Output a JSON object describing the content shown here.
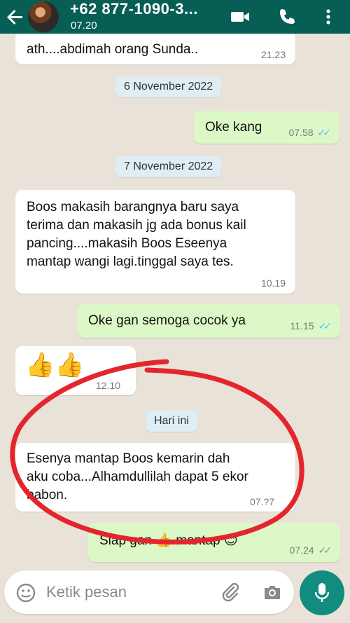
{
  "header": {
    "back_icon": "arrow-left-icon",
    "contact_name": "+62 877-1090-3...",
    "last_seen": "07.20",
    "video_icon": "video-call-icon",
    "call_icon": "phone-icon",
    "menu_icon": "more-vertical-icon"
  },
  "messages": [
    {
      "dir": "in",
      "text": "ath....abdimah orang Sunda..",
      "time": "21.23"
    },
    {
      "type": "date",
      "text": "6 November 2022"
    },
    {
      "dir": "out",
      "text": "Oke kang",
      "time": "07.58",
      "status": "read"
    },
    {
      "type": "date",
      "text": "7 November 2022"
    },
    {
      "dir": "in",
      "lines": [
        "Boos makasih barangnya baru saya",
        "terima dan makasih jg ada bonus kail",
        "pancing....makasih Boos Eseenya",
        "mantap wangi lagi.tinggal saya tes."
      ],
      "time": "10.19"
    },
    {
      "dir": "out",
      "text": "Oke gan semoga cocok ya",
      "time": "11.15",
      "status": "read"
    },
    {
      "dir": "in",
      "text": "👍👍",
      "time": "12.10"
    },
    {
      "type": "date",
      "text": "Hari ini"
    },
    {
      "dir": "in",
      "lines": [
        "Esenya mantap Boos kemarin dah",
        "aku coba...Alhamdullilah dapat 5 ekor",
        "babon."
      ],
      "time": "07.?7"
    },
    {
      "dir": "out",
      "text_parts": [
        "Siap gan",
        "👍",
        "mantap",
        "😊"
      ],
      "time": "07.24",
      "status": "delivered"
    }
  ],
  "input": {
    "placeholder": "Ketik pesan",
    "emoji_icon": "emoji-icon",
    "attach_icon": "paperclip-icon",
    "camera_icon": "camera-icon",
    "mic_icon": "microphone-icon"
  },
  "colors": {
    "header": "#075e54",
    "outgoing_bubble": "#dcf8c6",
    "incoming_bubble": "#ffffff",
    "read_ticks": "#4fc3f7",
    "annotation": "#e3262e"
  }
}
